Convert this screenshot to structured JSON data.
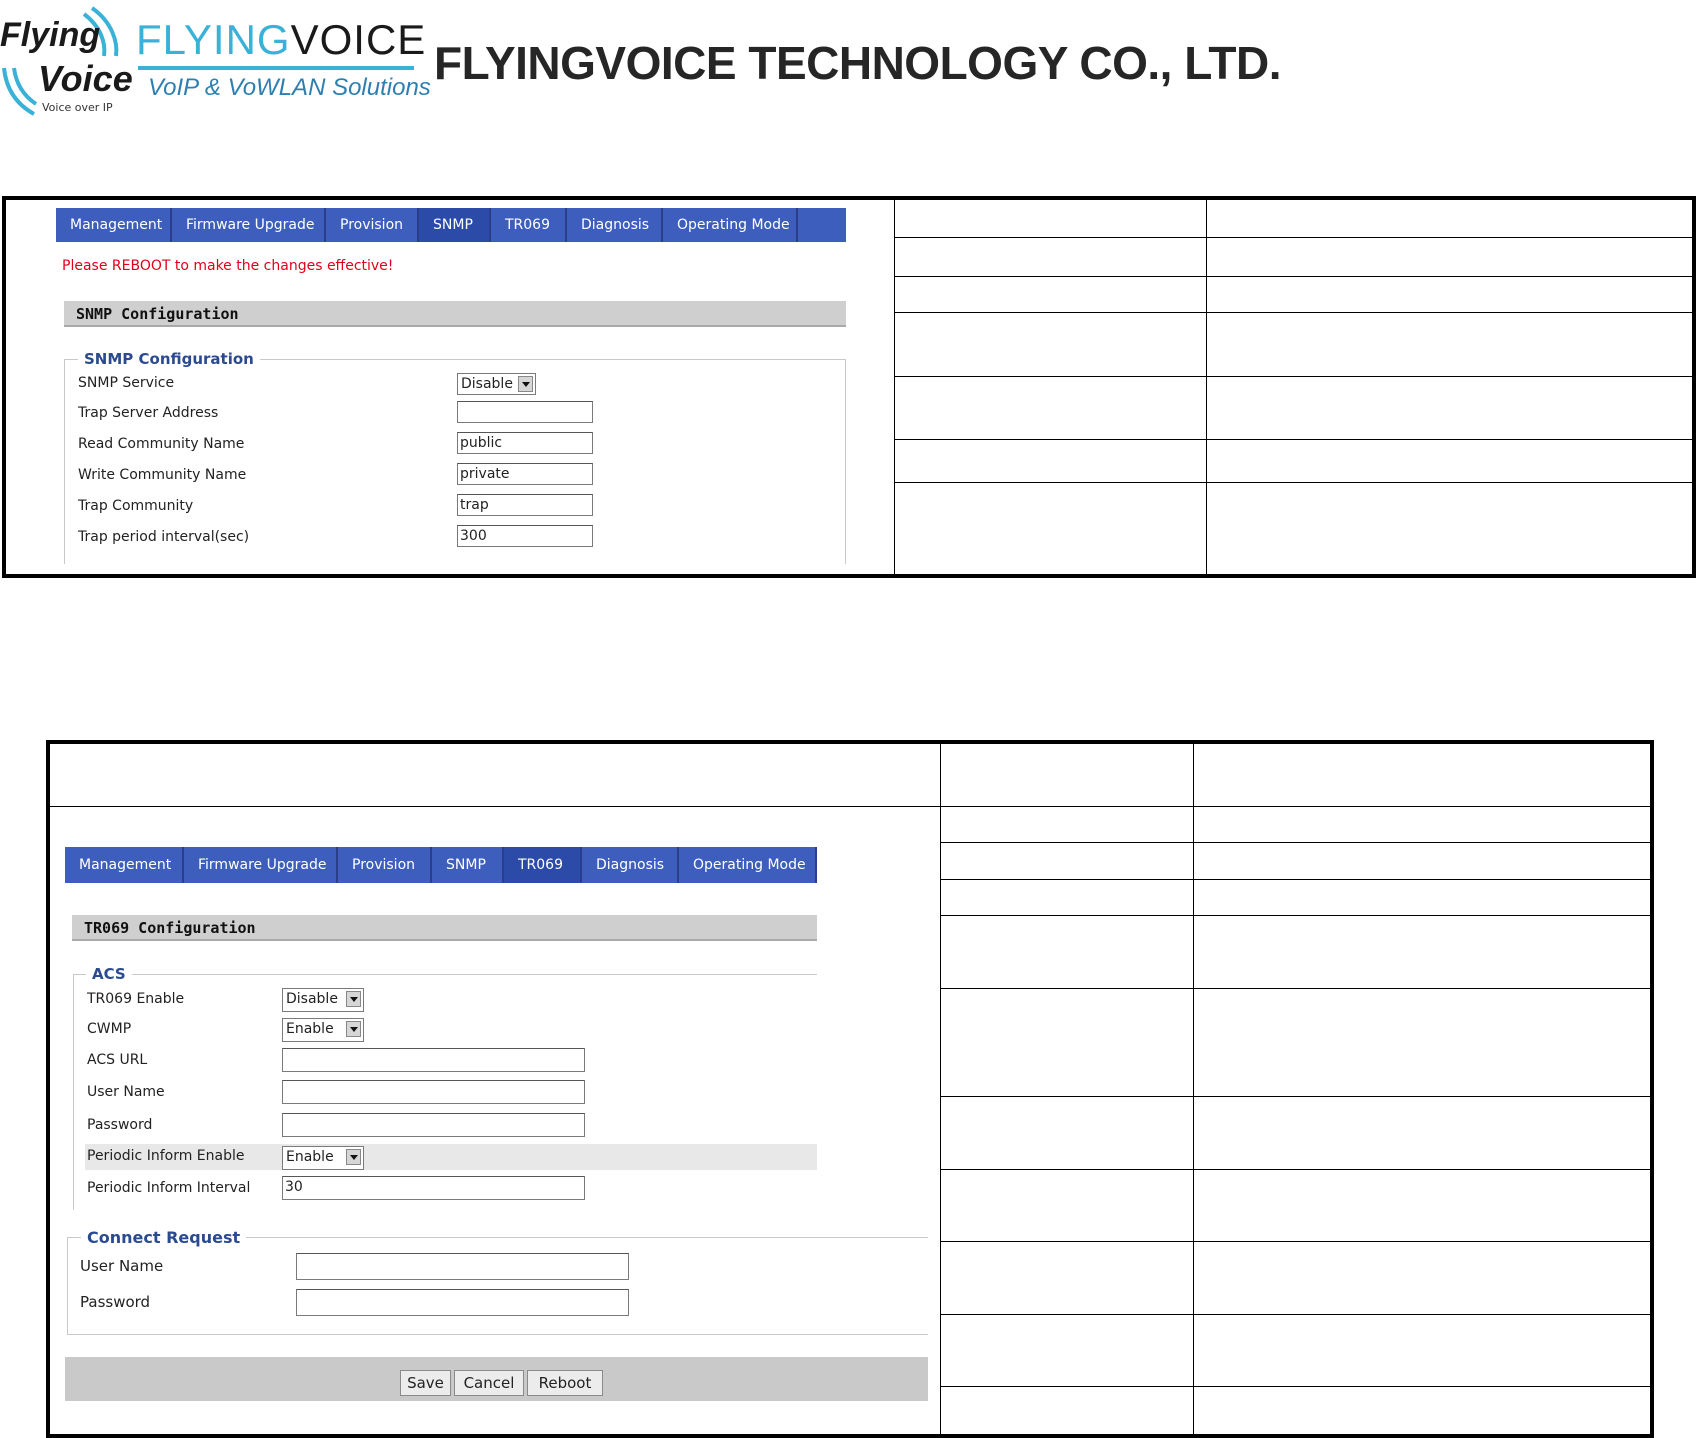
{
  "header": {
    "logo_line1": "Flying",
    "logo_line2": "Voice",
    "logo_tagline": "Voice over IP",
    "brand_part1": "FLYING",
    "brand_part2": "VOICE",
    "brand_subtitle": "VoIP & VoWLAN Solutions",
    "company_name": "FLYINGVOICE TECHNOLOGY CO., LTD."
  },
  "tabs": [
    "Management",
    "Firmware Upgrade",
    "Provision",
    "SNMP",
    "TR069",
    "Diagnosis",
    "Operating Mode"
  ],
  "snmp": {
    "active_tab": "SNMP",
    "reboot_notice": "Please REBOOT to make the changes effective!",
    "section_title": "SNMP Configuration",
    "group_legend": "SNMP Configuration",
    "fields": [
      {
        "label": "SNMP Service",
        "type": "select",
        "value": "Disable"
      },
      {
        "label": "Trap Server Address",
        "type": "text",
        "value": ""
      },
      {
        "label": "Read Community Name",
        "type": "text",
        "value": "public"
      },
      {
        "label": "Write Community Name",
        "type": "text",
        "value": "private"
      },
      {
        "label": "Trap Community",
        "type": "text",
        "value": "trap"
      },
      {
        "label": "Trap period interval(sec)",
        "type": "text",
        "value": "300"
      }
    ]
  },
  "tr069": {
    "active_tab": "TR069",
    "section_title": "TR069 Configuration",
    "acs_legend": "ACS",
    "acs_fields": [
      {
        "label": "TR069 Enable",
        "type": "select",
        "value": "Disable"
      },
      {
        "label": "CWMP",
        "type": "select",
        "value": "Enable"
      },
      {
        "label": "ACS URL",
        "type": "text",
        "value": ""
      },
      {
        "label": "User Name",
        "type": "text",
        "value": ""
      },
      {
        "label": "Password",
        "type": "text",
        "value": ""
      },
      {
        "label": "Periodic Inform Enable",
        "type": "select",
        "value": "Enable"
      },
      {
        "label": "Periodic Inform Interval",
        "type": "text",
        "value": "30"
      }
    ],
    "connect_legend": "Connect Request",
    "connect_fields": [
      {
        "label": "User Name",
        "type": "text",
        "value": ""
      },
      {
        "label": "Password",
        "type": "text",
        "value": ""
      }
    ],
    "buttons": {
      "save": "Save",
      "cancel": "Cancel",
      "reboot": "Reboot"
    }
  }
}
